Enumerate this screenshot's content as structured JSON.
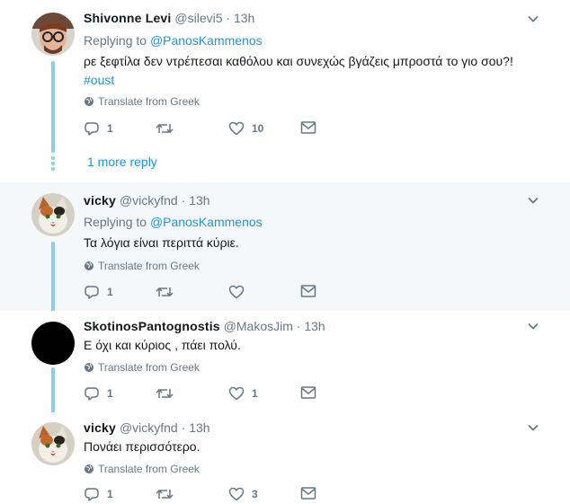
{
  "tweets": [
    {
      "name": "Shivonne Levi",
      "handle": "@silevi5",
      "time": "13h",
      "replying_label": "Replying to",
      "replying_to": "@PanosKammenos",
      "text": "ρε ξεφτίλα δεν ντρέπεσαι καθόλου και συνεχώς βγάζεις μπροστά το γιο σου?!",
      "hashtag": "#oust",
      "translate": "Translate from Greek",
      "replies": "1",
      "retweets": "",
      "likes": "10",
      "more_reply": "1 more reply"
    },
    {
      "name": "vicky",
      "handle": "@vickyfnd",
      "time": "13h",
      "replying_label": "Replying to",
      "replying_to": "@PanosKammenos",
      "text": "Τα λόγια είναι περιττά κύριε.",
      "translate": "Translate from Greek",
      "replies": "1",
      "retweets": "",
      "likes": ""
    },
    {
      "name": "SkotinosPantognostis",
      "handle": "@MakosJim",
      "time": "13h",
      "text": "Ε όχι και κύριος , πάει πολύ.",
      "translate": "Translate from Greek",
      "replies": "1",
      "retweets": "",
      "likes": "1"
    },
    {
      "name": "vicky",
      "handle": "@vickyfnd",
      "time": "13h",
      "text": "Πονάει  περισσότερο.",
      "translate": "Translate from Greek",
      "replies": "1",
      "retweets": "",
      "likes": "3"
    }
  ],
  "separator": "·",
  "colors": {
    "link": "#1b95e0",
    "muted": "#657786",
    "thread": "#8ecdea",
    "highlight_bg": "#f5f8fa"
  },
  "icons": [
    "reply-icon",
    "retweet-icon",
    "like-icon",
    "dm-icon",
    "globe-icon",
    "chevron-down-icon"
  ]
}
